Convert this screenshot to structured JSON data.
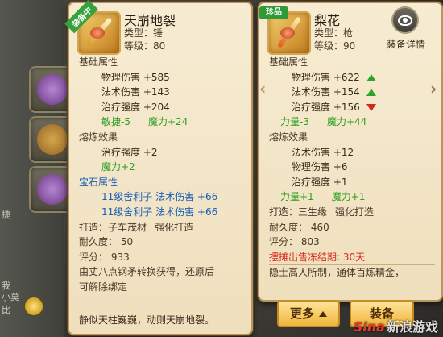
{
  "left_panel": {
    "ribbon": "装备中",
    "name": "天崩地裂",
    "type_line": "类型：锤",
    "level_line": "等级：80",
    "base_title": "基础属性",
    "base_stats": [
      "物理伤害 +585",
      "法术伤害 +143",
      "治疗强度 +204"
    ],
    "base_extra": [
      "敏捷-5",
      "魔力+24"
    ],
    "refine_title": "熔炼效果",
    "refine_stats": [
      "治疗强度 +2"
    ],
    "refine_extra": "魔力+2",
    "gem_title": "宝石属性",
    "gem_stats": [
      {
        "gem": "11级舍利子",
        "stat": "法术伤害 +66"
      },
      {
        "gem": "11级舍利子",
        "stat": "法术伤害 +66"
      }
    ],
    "forge_label": "打造：",
    "forge_maker": "子车茂材",
    "forge_type": "强化打造",
    "durability": "耐久度： 50",
    "score": "评分： 933",
    "desc": [
      "由丈八点钢矛转换获得，还原后",
      "可解除绑定"
    ],
    "footer": "静似天柱巍巍，动则天崩地裂。"
  },
  "right_panel": {
    "ribbon": "珍品",
    "name": "梨花",
    "type_line": "类型：枪",
    "level_line": "等级：90",
    "detail_label": "装备详情",
    "base_title": "基础属性",
    "base_stats": [
      {
        "text": "物理伤害 +622",
        "trend": "up"
      },
      {
        "text": "法术伤害 +154",
        "trend": "up"
      },
      {
        "text": "治疗强度 +156",
        "trend": "down"
      }
    ],
    "base_extra": [
      "力量-3",
      "魔力+44"
    ],
    "refine_title": "熔炼效果",
    "refine_stats": [
      "法术伤害 +12",
      "物理伤害 +6",
      "治疗强度 +1"
    ],
    "refine_extra": [
      "力量+1",
      "魔力+1"
    ],
    "forge_label": "打造：",
    "forge_maker": "三生缘",
    "forge_type": "强化打造",
    "durability": "耐久度： 460",
    "score": "评分： 803",
    "warning": "摆摊出售冻结期: 30天",
    "desc": "隐士高人所制，通体百炼精金，",
    "btn_more": "更多",
    "btn_equip": "装备"
  },
  "background": {
    "side_text": [
      "捷",
      "我",
      "小莫",
      "比"
    ]
  },
  "watermark": "新浪游戏",
  "watermark_logo": "Sina",
  "colors": {
    "panel_bg": "#f7ecd3",
    "green": "#2f9e1f",
    "blue": "#1b5fb6",
    "red": "#d92a1c",
    "ribbon_green": "#36a23c"
  }
}
